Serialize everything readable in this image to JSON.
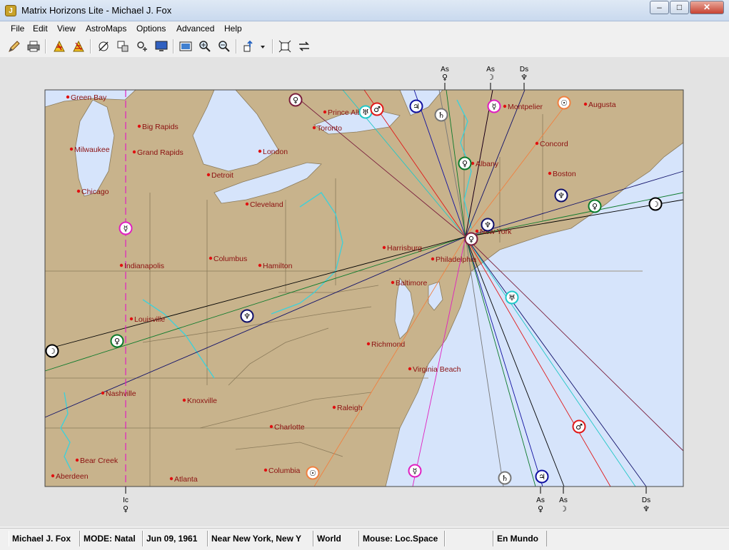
{
  "window": {
    "title": "Matrix Horizons Lite - Michael J. Fox",
    "app_icon": "J"
  },
  "menu": [
    "File",
    "Edit",
    "View",
    "AstroMaps",
    "Options",
    "Advanced",
    "Help"
  ],
  "toolbar": [
    "edit-chart-icon",
    "print-icon",
    "chart-wheel-icon",
    "chart-grid-icon",
    "compass-icon",
    "resize-icon",
    "add-planet-icon",
    "monitor-icon",
    "slideshow-icon",
    "zoom-in-icon",
    "zoom-out-icon",
    "location-icon",
    "dropdown-arrow-icon",
    "fit-icon",
    "swap-icon"
  ],
  "cities": [
    {
      "name": "Green Bay"
    },
    {
      "name": "Prince Albert"
    },
    {
      "name": "Toronto"
    },
    {
      "name": "Montpelier"
    },
    {
      "name": "Augusta"
    },
    {
      "name": "Big Rapids"
    },
    {
      "name": "Milwaukee"
    },
    {
      "name": "Grand Rapids"
    },
    {
      "name": "London"
    },
    {
      "name": "Concord"
    },
    {
      "name": "Detroit"
    },
    {
      "name": "Albany"
    },
    {
      "name": "Boston"
    },
    {
      "name": "Chicago"
    },
    {
      "name": "Cleveland"
    },
    {
      "name": "New York"
    },
    {
      "name": "Harrisburg"
    },
    {
      "name": "Columbus"
    },
    {
      "name": "Philadelphia"
    },
    {
      "name": "Indianapolis"
    },
    {
      "name": "Hamilton"
    },
    {
      "name": "Baltimore"
    },
    {
      "name": "Louisville"
    },
    {
      "name": "Richmond"
    },
    {
      "name": "Virginia Beach"
    },
    {
      "name": "Nashville"
    },
    {
      "name": "Knoxville"
    },
    {
      "name": "Raleigh"
    },
    {
      "name": "Charlotte"
    },
    {
      "name": "Bear Creek"
    },
    {
      "name": "Columbia"
    },
    {
      "name": "Aberdeen"
    },
    {
      "name": "Atlanta"
    }
  ],
  "line_labels": {
    "top": [
      {
        "angle": "As",
        "planet": "♀"
      },
      {
        "angle": "As",
        "planet": "☽"
      },
      {
        "angle": "Ds",
        "planet": "♆"
      }
    ],
    "bottom": [
      {
        "angle": "Ic",
        "planet": "♀"
      },
      {
        "angle": "As",
        "planet": "♀"
      },
      {
        "angle": "As",
        "planet": "☽"
      },
      {
        "angle": "Ds",
        "planet": "♆"
      }
    ]
  },
  "planet_markers": [
    {
      "glyph": "♀",
      "color": "#7a1f3d"
    },
    {
      "glyph": "♅",
      "color": "#20c8c8"
    },
    {
      "glyph": "♂",
      "color": "#e01818"
    },
    {
      "glyph": "♃",
      "color": "#1010a0"
    },
    {
      "glyph": "♄",
      "color": "#777777"
    },
    {
      "glyph": "☿",
      "color": "#e020c0"
    },
    {
      "glyph": "☉",
      "color": "#f08040"
    },
    {
      "glyph": "♀",
      "color": "#0b7a2a"
    },
    {
      "glyph": "♆",
      "color": "#10106a"
    },
    {
      "glyph": "♀",
      "color": "#0b7a2a"
    },
    {
      "glyph": "☽",
      "color": "#000000"
    },
    {
      "glyph": "♆",
      "color": "#10106a"
    },
    {
      "glyph": "♀",
      "color": "#7a1f3d"
    },
    {
      "glyph": "☿",
      "color": "#e020c0"
    },
    {
      "glyph": "♅",
      "color": "#20c8c8"
    },
    {
      "glyph": "♆",
      "color": "#10106a"
    },
    {
      "glyph": "☽",
      "color": "#000000"
    },
    {
      "glyph": "♀",
      "color": "#0b7a2a"
    },
    {
      "glyph": "♂",
      "color": "#e01818"
    },
    {
      "glyph": "☿",
      "color": "#e020c0"
    },
    {
      "glyph": "☉",
      "color": "#f08040"
    },
    {
      "glyph": "♄",
      "color": "#777777"
    },
    {
      "glyph": "♃",
      "color": "#1010a0"
    }
  ],
  "colors": {
    "land": "#c8b38c",
    "water": "#d6e4fb",
    "city_dot": "#e01010",
    "city_label": "#8b1010",
    "border": "#8a7a5a",
    "river": "#40d0d8"
  },
  "status": [
    "Michael J. Fox",
    "MODE: Natal",
    "Jun 09, 1961",
    "Near New York, New Y",
    "World",
    "Mouse: Loc.Space",
    "",
    "En Mundo"
  ]
}
